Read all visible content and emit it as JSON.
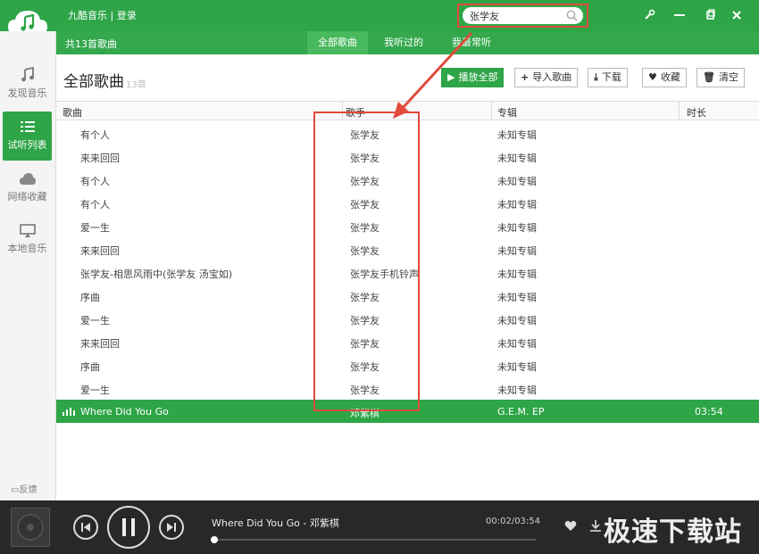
{
  "app": {
    "user_text": "九酷音乐 | 登录",
    "search_value": "张学友",
    "accent": "#2ea547"
  },
  "subbar": {
    "count_text": "共13首歌曲",
    "tabs": [
      "全部歌曲",
      "我听过的",
      "我最常听"
    ]
  },
  "sidebar": {
    "items": [
      {
        "label": "发现音乐",
        "icon": "music-note-icon"
      },
      {
        "label": "试听列表",
        "icon": "list-icon"
      },
      {
        "label": "网络收藏",
        "icon": "cloud-icon"
      },
      {
        "label": "本地音乐",
        "icon": "monitor-icon"
      }
    ],
    "feedback": "反馈"
  },
  "main": {
    "title": "全部歌曲",
    "title_count": "13首",
    "buttons": {
      "play_all": "播放全部",
      "import": "导入歌曲",
      "download": "下载",
      "favorite": "收藏",
      "clear": "清空"
    },
    "columns": [
      "歌曲",
      "歌手",
      "专辑",
      "时长"
    ],
    "rows": [
      {
        "song": "有个人",
        "artist": "张学友",
        "album": "未知专辑",
        "duration": ""
      },
      {
        "song": "来来回回",
        "artist": "张学友",
        "album": "未知专辑",
        "duration": ""
      },
      {
        "song": "有个人",
        "artist": "张学友",
        "album": "未知专辑",
        "duration": ""
      },
      {
        "song": "有个人",
        "artist": "张学友",
        "album": "未知专辑",
        "duration": ""
      },
      {
        "song": "爱一生",
        "artist": "张学友",
        "album": "未知专辑",
        "duration": ""
      },
      {
        "song": "来来回回",
        "artist": "张学友",
        "album": "未知专辑",
        "duration": ""
      },
      {
        "song": "张学友-相思风雨中(张学友 汤宝如)",
        "artist": "张学友手机铃声",
        "album": "未知专辑",
        "duration": ""
      },
      {
        "song": "序曲",
        "artist": "张学友",
        "album": "未知专辑",
        "duration": ""
      },
      {
        "song": "爱一生",
        "artist": "张学友",
        "album": "未知专辑",
        "duration": ""
      },
      {
        "song": "来来回回",
        "artist": "张学友",
        "album": "未知专辑",
        "duration": ""
      },
      {
        "song": "序曲",
        "artist": "张学友",
        "album": "未知专辑",
        "duration": ""
      },
      {
        "song": "爱一生",
        "artist": "张学友",
        "album": "未知专辑",
        "duration": ""
      },
      {
        "song": "Where Did You Go",
        "artist": "邓紫棋",
        "album": "G.E.M. EP",
        "duration": "03:54"
      }
    ]
  },
  "player": {
    "now_playing": "Where Did You Go - 邓紫棋",
    "time": "00:02/03:54",
    "progress_fraction": 0.0085
  },
  "watermark": "极速下载站"
}
